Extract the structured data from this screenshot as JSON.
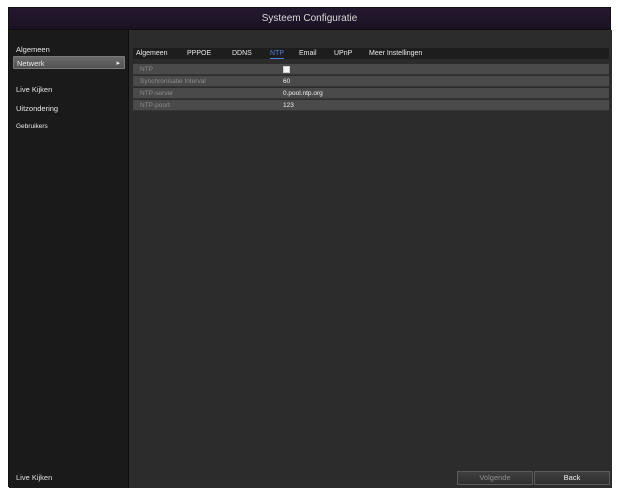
{
  "window": {
    "title": "Systeem Configuratie"
  },
  "sidebar": {
    "items": [
      {
        "label": "Algemeen"
      },
      {
        "label": "Netwerk"
      },
      {
        "label": "Live Kijken"
      },
      {
        "label": "Uitzondering"
      },
      {
        "label": "Gebruikers"
      }
    ],
    "active_arrow": "▸",
    "bottom_label": "Live Kijken"
  },
  "tabs": [
    {
      "label": "Algemeen"
    },
    {
      "label": "PPPOE"
    },
    {
      "label": "DDNS"
    },
    {
      "label": "NTP"
    },
    {
      "label": "Email"
    },
    {
      "label": "UPnP"
    },
    {
      "label": "Meer Instellingen"
    }
  ],
  "ntp": {
    "enable_label": "NTP",
    "enable_checked": true,
    "interval_label": "Synchronisatie Interval",
    "interval_value": "60",
    "server_label": "NTP-server",
    "server_value": "0.pool.ntp.org",
    "port_label": "NTP-poort",
    "port_value": "123"
  },
  "buttons": {
    "next_label": "Volgende",
    "back_label": "Back"
  }
}
